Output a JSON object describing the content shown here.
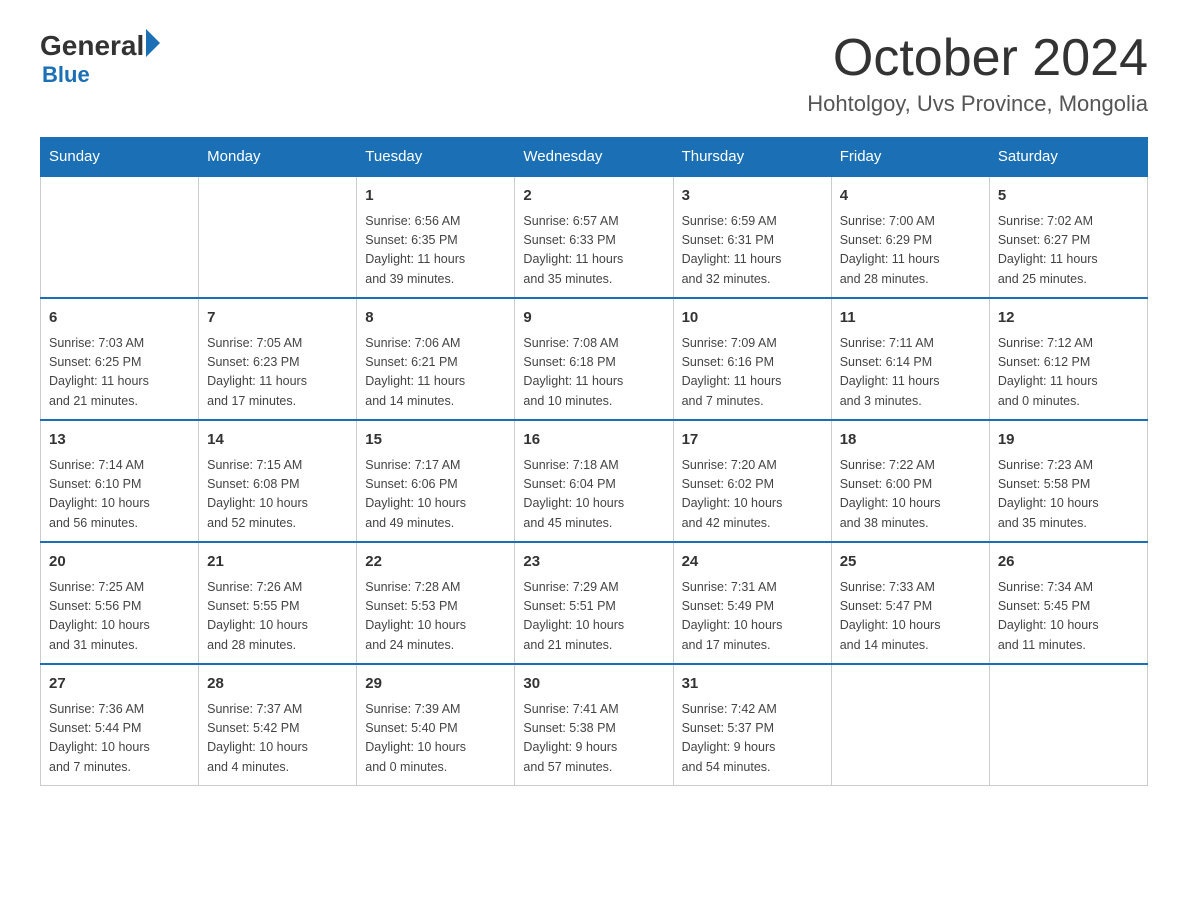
{
  "logo": {
    "text_general": "General",
    "text_blue": "Blue",
    "triangle_color": "#1a6fb5"
  },
  "header": {
    "month_title": "October 2024",
    "location": "Hohtolgoy, Uvs Province, Mongolia"
  },
  "days_of_week": [
    "Sunday",
    "Monday",
    "Tuesday",
    "Wednesday",
    "Thursday",
    "Friday",
    "Saturday"
  ],
  "weeks": [
    [
      {
        "day": "",
        "info": ""
      },
      {
        "day": "",
        "info": ""
      },
      {
        "day": "1",
        "info": "Sunrise: 6:56 AM\nSunset: 6:35 PM\nDaylight: 11 hours\nand 39 minutes."
      },
      {
        "day": "2",
        "info": "Sunrise: 6:57 AM\nSunset: 6:33 PM\nDaylight: 11 hours\nand 35 minutes."
      },
      {
        "day": "3",
        "info": "Sunrise: 6:59 AM\nSunset: 6:31 PM\nDaylight: 11 hours\nand 32 minutes."
      },
      {
        "day": "4",
        "info": "Sunrise: 7:00 AM\nSunset: 6:29 PM\nDaylight: 11 hours\nand 28 minutes."
      },
      {
        "day": "5",
        "info": "Sunrise: 7:02 AM\nSunset: 6:27 PM\nDaylight: 11 hours\nand 25 minutes."
      }
    ],
    [
      {
        "day": "6",
        "info": "Sunrise: 7:03 AM\nSunset: 6:25 PM\nDaylight: 11 hours\nand 21 minutes."
      },
      {
        "day": "7",
        "info": "Sunrise: 7:05 AM\nSunset: 6:23 PM\nDaylight: 11 hours\nand 17 minutes."
      },
      {
        "day": "8",
        "info": "Sunrise: 7:06 AM\nSunset: 6:21 PM\nDaylight: 11 hours\nand 14 minutes."
      },
      {
        "day": "9",
        "info": "Sunrise: 7:08 AM\nSunset: 6:18 PM\nDaylight: 11 hours\nand 10 minutes."
      },
      {
        "day": "10",
        "info": "Sunrise: 7:09 AM\nSunset: 6:16 PM\nDaylight: 11 hours\nand 7 minutes."
      },
      {
        "day": "11",
        "info": "Sunrise: 7:11 AM\nSunset: 6:14 PM\nDaylight: 11 hours\nand 3 minutes."
      },
      {
        "day": "12",
        "info": "Sunrise: 7:12 AM\nSunset: 6:12 PM\nDaylight: 11 hours\nand 0 minutes."
      }
    ],
    [
      {
        "day": "13",
        "info": "Sunrise: 7:14 AM\nSunset: 6:10 PM\nDaylight: 10 hours\nand 56 minutes."
      },
      {
        "day": "14",
        "info": "Sunrise: 7:15 AM\nSunset: 6:08 PM\nDaylight: 10 hours\nand 52 minutes."
      },
      {
        "day": "15",
        "info": "Sunrise: 7:17 AM\nSunset: 6:06 PM\nDaylight: 10 hours\nand 49 minutes."
      },
      {
        "day": "16",
        "info": "Sunrise: 7:18 AM\nSunset: 6:04 PM\nDaylight: 10 hours\nand 45 minutes."
      },
      {
        "day": "17",
        "info": "Sunrise: 7:20 AM\nSunset: 6:02 PM\nDaylight: 10 hours\nand 42 minutes."
      },
      {
        "day": "18",
        "info": "Sunrise: 7:22 AM\nSunset: 6:00 PM\nDaylight: 10 hours\nand 38 minutes."
      },
      {
        "day": "19",
        "info": "Sunrise: 7:23 AM\nSunset: 5:58 PM\nDaylight: 10 hours\nand 35 minutes."
      }
    ],
    [
      {
        "day": "20",
        "info": "Sunrise: 7:25 AM\nSunset: 5:56 PM\nDaylight: 10 hours\nand 31 minutes."
      },
      {
        "day": "21",
        "info": "Sunrise: 7:26 AM\nSunset: 5:55 PM\nDaylight: 10 hours\nand 28 minutes."
      },
      {
        "day": "22",
        "info": "Sunrise: 7:28 AM\nSunset: 5:53 PM\nDaylight: 10 hours\nand 24 minutes."
      },
      {
        "day": "23",
        "info": "Sunrise: 7:29 AM\nSunset: 5:51 PM\nDaylight: 10 hours\nand 21 minutes."
      },
      {
        "day": "24",
        "info": "Sunrise: 7:31 AM\nSunset: 5:49 PM\nDaylight: 10 hours\nand 17 minutes."
      },
      {
        "day": "25",
        "info": "Sunrise: 7:33 AM\nSunset: 5:47 PM\nDaylight: 10 hours\nand 14 minutes."
      },
      {
        "day": "26",
        "info": "Sunrise: 7:34 AM\nSunset: 5:45 PM\nDaylight: 10 hours\nand 11 minutes."
      }
    ],
    [
      {
        "day": "27",
        "info": "Sunrise: 7:36 AM\nSunset: 5:44 PM\nDaylight: 10 hours\nand 7 minutes."
      },
      {
        "day": "28",
        "info": "Sunrise: 7:37 AM\nSunset: 5:42 PM\nDaylight: 10 hours\nand 4 minutes."
      },
      {
        "day": "29",
        "info": "Sunrise: 7:39 AM\nSunset: 5:40 PM\nDaylight: 10 hours\nand 0 minutes."
      },
      {
        "day": "30",
        "info": "Sunrise: 7:41 AM\nSunset: 5:38 PM\nDaylight: 9 hours\nand 57 minutes."
      },
      {
        "day": "31",
        "info": "Sunrise: 7:42 AM\nSunset: 5:37 PM\nDaylight: 9 hours\nand 54 minutes."
      },
      {
        "day": "",
        "info": ""
      },
      {
        "day": "",
        "info": ""
      }
    ]
  ]
}
